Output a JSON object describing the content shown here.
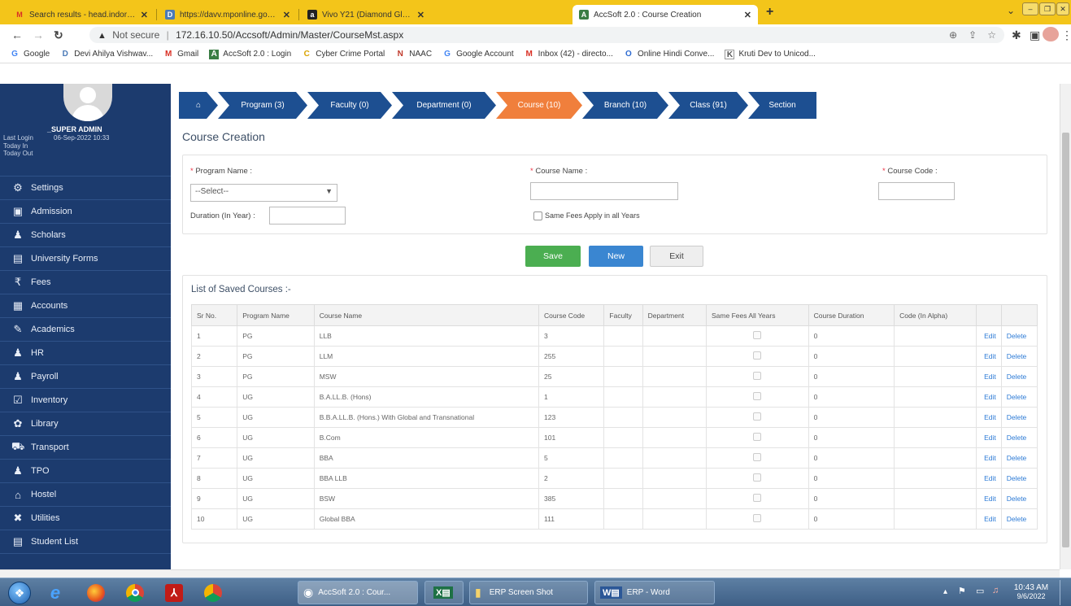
{
  "browser": {
    "tabs": [
      {
        "title": "Search results - head.indoreinst",
        "icon": "M"
      },
      {
        "title": "https://davv.mponline.gov.in/po",
        "icon": "D"
      },
      {
        "title": "Vivo Y21 (Diamond Glow, 4GB R",
        "icon": "a"
      },
      {
        "title": "AccSoft 2.0 : Course Creation",
        "icon": "A"
      }
    ],
    "new_tab": "+",
    "url_secure": "Not secure",
    "url": "172.16.10.50/Accsoft/Admin/Master/CourseMst.aspx",
    "bookmarks": [
      {
        "label": "Google",
        "icon": "G"
      },
      {
        "label": "Devi Ahilya Vishwav...",
        "icon": "D"
      },
      {
        "label": "Gmail",
        "icon": "M"
      },
      {
        "label": "AccSoft 2.0 : Login",
        "icon": "A"
      },
      {
        "label": "Cyber Crime Portal",
        "icon": "C"
      },
      {
        "label": "NAAC",
        "icon": "N"
      },
      {
        "label": "Google Account",
        "icon": "G"
      },
      {
        "label": "Inbox (42) - directo...",
        "icon": "M"
      },
      {
        "label": "Online Hindi Conve...",
        "icon": "O"
      },
      {
        "label": "Kruti Dev to Unicod...",
        "icon": "K"
      }
    ]
  },
  "sidebar": {
    "user": "_SUPER ADMIN",
    "last_login_label": "Last Login",
    "last_login_value": "06-Sep-2022 10:33",
    "today_in": "Today In",
    "today_out": "Today Out",
    "items": [
      {
        "label": "Settings",
        "icon": "⚙"
      },
      {
        "label": "Admission",
        "icon": "▣"
      },
      {
        "label": "Scholars",
        "icon": "♟"
      },
      {
        "label": "University Forms",
        "icon": "▤"
      },
      {
        "label": "Fees",
        "icon": "₹"
      },
      {
        "label": "Accounts",
        "icon": "▦"
      },
      {
        "label": "Academics",
        "icon": "✎"
      },
      {
        "label": "HR",
        "icon": "♟"
      },
      {
        "label": "Payroll",
        "icon": "♟"
      },
      {
        "label": "Inventory",
        "icon": "☑"
      },
      {
        "label": "Library",
        "icon": "✿"
      },
      {
        "label": "Transport",
        "icon": "⛟"
      },
      {
        "label": "TPO",
        "icon": "♟"
      },
      {
        "label": "Hostel",
        "icon": "⌂"
      },
      {
        "label": "Utilities",
        "icon": "✖"
      },
      {
        "label": "Student List",
        "icon": "▤"
      }
    ]
  },
  "steps": [
    {
      "label": "⌂"
    },
    {
      "label": "Program (3)"
    },
    {
      "label": "Faculty (0)"
    },
    {
      "label": "Department (0)"
    },
    {
      "label": "Course (10)"
    },
    {
      "label": "Branch (10)"
    },
    {
      "label": "Class (91)"
    },
    {
      "label": "Section"
    }
  ],
  "page_title": "Course Creation",
  "form": {
    "program_label": "Program Name :",
    "program_value": "--Select--",
    "course_name_label": "Course Name :",
    "course_code_label": "Course Code :",
    "duration_label": "Duration (In Year) :",
    "same_fees_label": "Same Fees Apply in all Years",
    "required_mark": "*"
  },
  "buttons": {
    "save": "Save",
    "new": "New",
    "exit": "Exit"
  },
  "list_title": "List of Saved Courses :-",
  "table": {
    "headers": [
      "Sr No.",
      "Program Name",
      "Course Name",
      "Course Code",
      "Faculty",
      "Department",
      "Same Fees All Years",
      "Course Duration",
      "Code (In Alpha)",
      "",
      ""
    ],
    "edit": "Edit",
    "delete": "Delete",
    "rows": [
      [
        "1",
        "PG",
        "LLB",
        "3",
        "",
        "",
        "",
        "0",
        ""
      ],
      [
        "2",
        "PG",
        "LLM",
        "255",
        "",
        "",
        "",
        "0",
        ""
      ],
      [
        "3",
        "PG",
        "MSW",
        "25",
        "",
        "",
        "",
        "0",
        ""
      ],
      [
        "4",
        "UG",
        "B.A.LL.B. (Hons)",
        "1",
        "",
        "",
        "",
        "0",
        ""
      ],
      [
        "5",
        "UG",
        "B.B.A.LL.B. (Hons.) With Global and Transnational",
        "123",
        "",
        "",
        "",
        "0",
        ""
      ],
      [
        "6",
        "UG",
        "B.Com",
        "101",
        "",
        "",
        "",
        "0",
        ""
      ],
      [
        "7",
        "UG",
        "BBA",
        "5",
        "",
        "",
        "",
        "0",
        ""
      ],
      [
        "8",
        "UG",
        "BBA LLB",
        "2",
        "",
        "",
        "",
        "0",
        ""
      ],
      [
        "9",
        "UG",
        "BSW",
        "385",
        "",
        "",
        "",
        "0",
        ""
      ],
      [
        "10",
        "UG",
        "Global BBA",
        "111",
        "",
        "",
        "",
        "0",
        ""
      ]
    ]
  },
  "taskbar": {
    "windows": [
      {
        "label": "AccSoft 2.0 : Cour..."
      },
      {
        "label": "ERP Screen Shot"
      },
      {
        "label": "ERP - Word"
      }
    ],
    "time": "10:43 AM",
    "date": "9/6/2022"
  }
}
